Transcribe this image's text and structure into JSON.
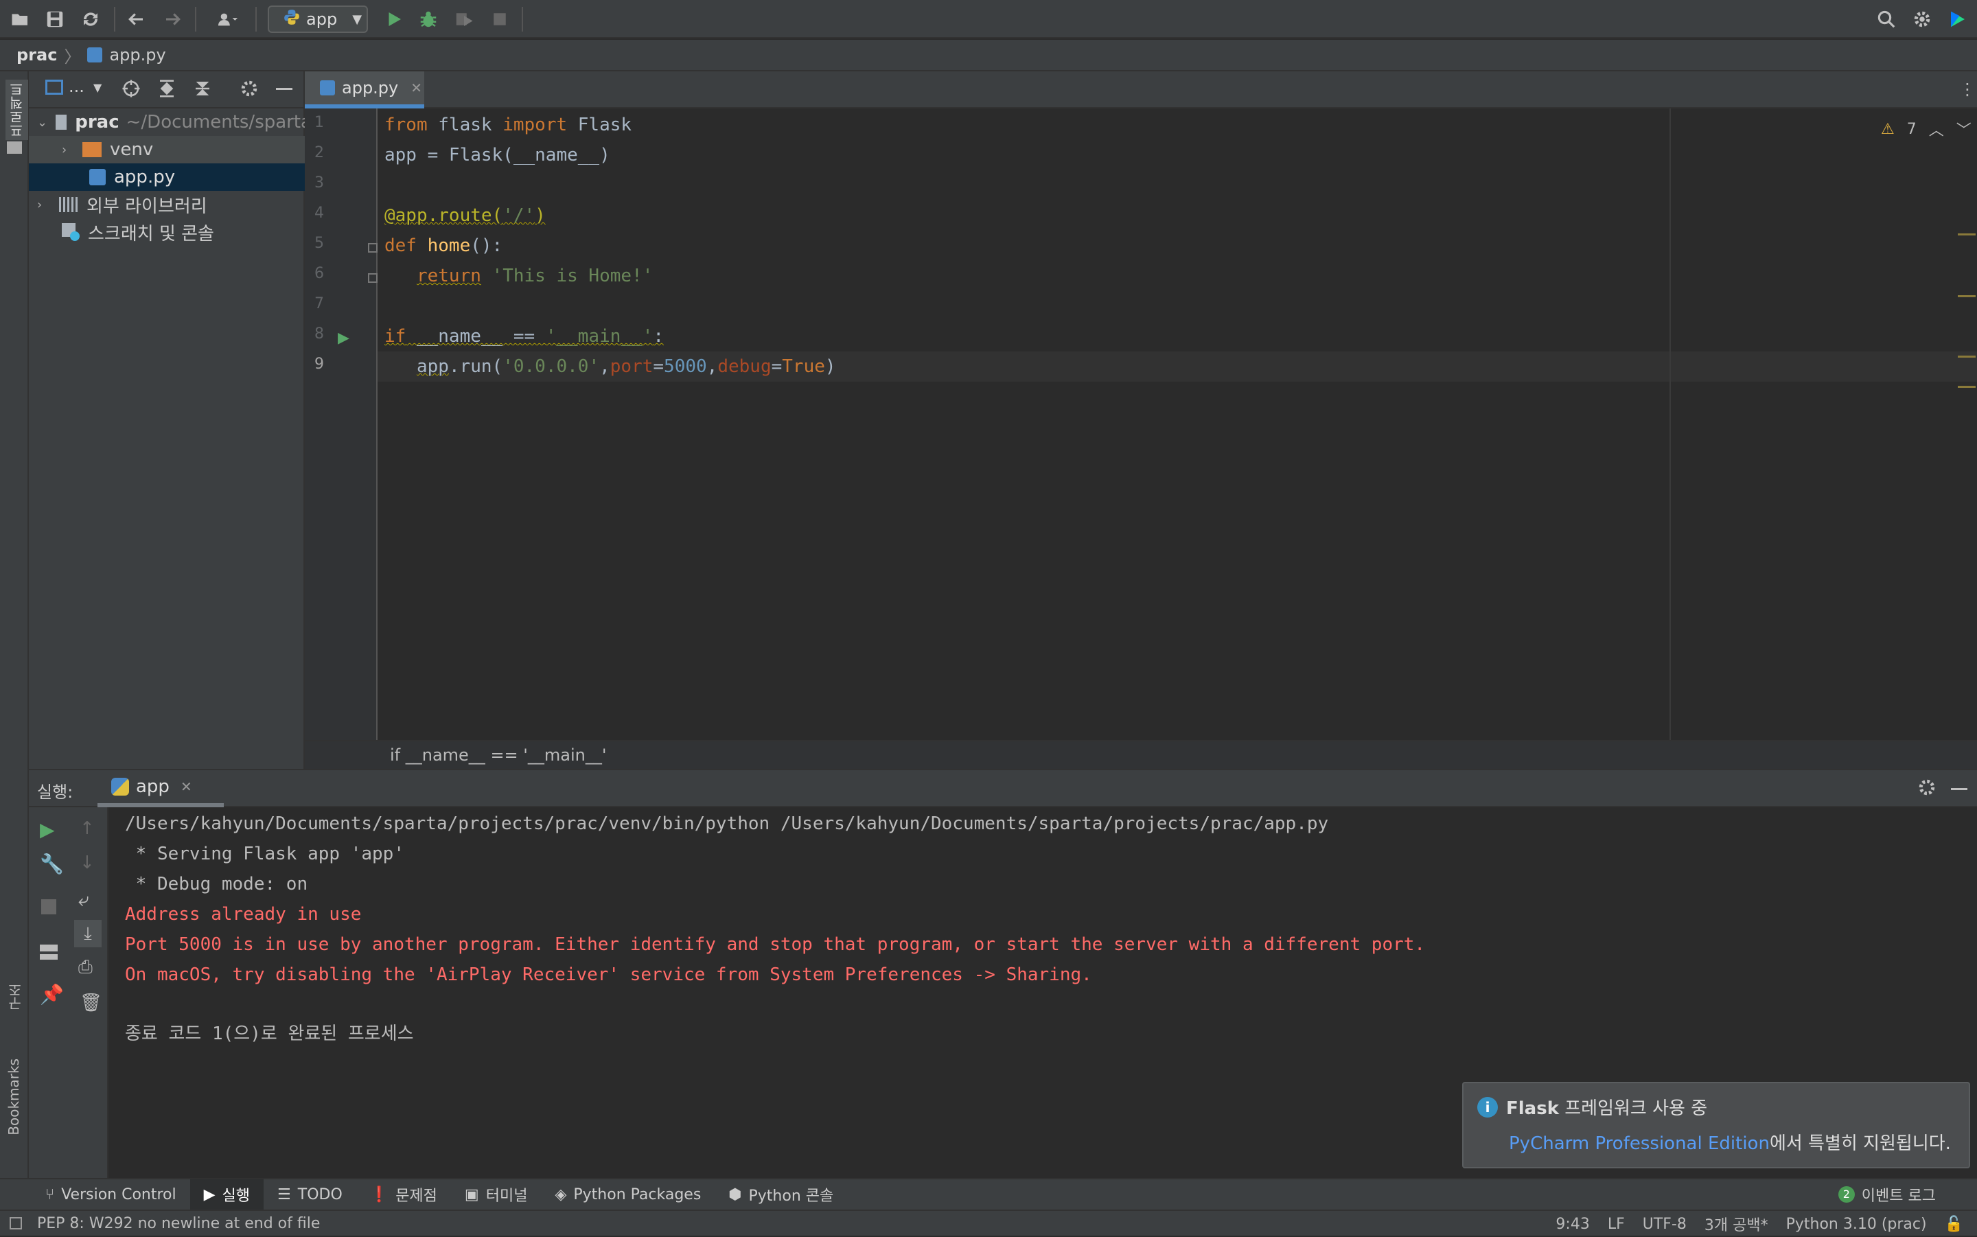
{
  "toolbar": {
    "run_config": "app",
    "icons": [
      "folder-open-icon",
      "save-icon",
      "sync-icon",
      "back-icon",
      "forward-icon",
      "user-icon",
      "run-icon",
      "debug-icon",
      "coverage-icon",
      "stop-icon",
      "search-icon",
      "settings-icon",
      "jetbrains-toolbox-icon"
    ]
  },
  "navbar": {
    "project": "prac",
    "file": "app.py"
  },
  "left_stripe": {
    "project_label": "프로젝트",
    "structure_label": "구조",
    "bookmarks_label": "Bookmarks"
  },
  "project_panel": {
    "header_label": "...",
    "tree": [
      {
        "label": "prac",
        "path": "~/Documents/sparta"
      },
      {
        "label": "venv"
      },
      {
        "label": "app.py"
      },
      {
        "label": "외부 라이브러리"
      },
      {
        "label": "스크래치 및 콘솔"
      }
    ]
  },
  "editor": {
    "tab_label": "app.py",
    "warning_count": "7",
    "line_numbers": [
      "1",
      "2",
      "3",
      "4",
      "5",
      "6",
      "7",
      "8",
      "9"
    ],
    "breadcrumb": "if __name__ == '__main__'"
  },
  "run_panel": {
    "label": "실행:",
    "tab_label": "app",
    "console": {
      "line1": "/Users/kahyun/Documents/sparta/projects/prac/venv/bin/python /Users/kahyun/Documents/sparta/projects/prac/app.py",
      "line2": " * Serving Flask app 'app'",
      "line3": " * Debug mode: on",
      "line4": "Address already in use",
      "line5": "Port 5000 is in use by another program. Either identify and stop that program, or start the server with a different port.",
      "line6": "On macOS, try disabling the 'AirPlay Receiver' service from System Preferences -> Sharing.",
      "line7": "종료 코드 1(으)로 완료된 프로세스"
    }
  },
  "notification": {
    "title": "Flask",
    "title_rest": " 프레임워크 사용 중",
    "link": "PyCharm Professional Edition",
    "rest": "에서 특별히 지원됩니다."
  },
  "tool_strip": {
    "tabs": [
      "Version Control",
      "실행",
      "TODO",
      "문제점",
      "터미널",
      "Python Packages",
      "Python 콘솔"
    ],
    "event_log_count": "2",
    "event_log_label": "이벤트 로그"
  },
  "status_bar": {
    "message": "PEP 8: W292 no newline at end of file",
    "position": "9:43",
    "line_sep": "LF",
    "encoding": "UTF-8",
    "indent": "3개 공백*",
    "interpreter": "Python 3.10 (prac)"
  }
}
